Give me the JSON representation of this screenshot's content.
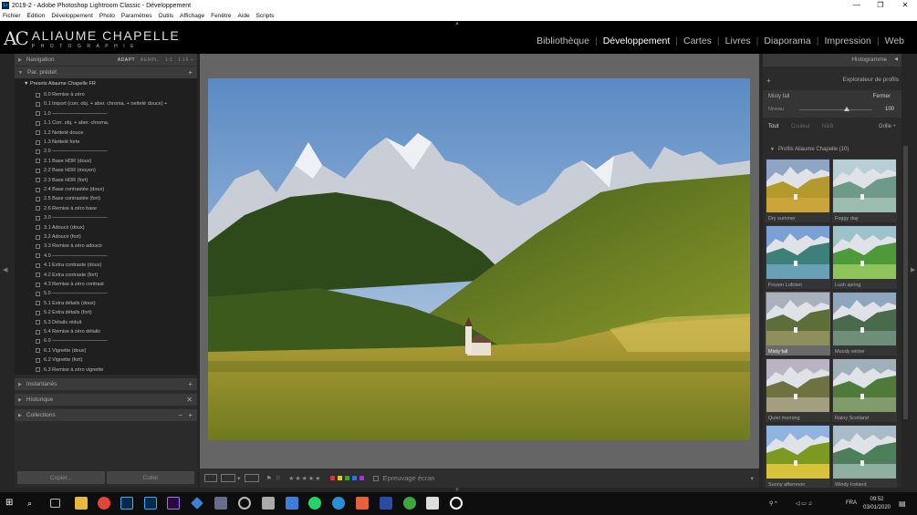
{
  "window": {
    "title": "2019-2 - Adobe Photoshop Lightroom Classic - Développement",
    "controls": [
      "—",
      "❐",
      "✕"
    ]
  },
  "menu": [
    "Fichier",
    "Edition",
    "Développement",
    "Photo",
    "Paramètres",
    "Outils",
    "Affichage",
    "Fenêtre",
    "Aide",
    "Scripts"
  ],
  "identity": {
    "mark": "AC",
    "name": "ALIAUME CHAPELLE",
    "subtitle": "PHOTOGRAPHIE"
  },
  "modules": [
    {
      "label": "Bibliothèque",
      "active": false
    },
    {
      "label": "Développement",
      "active": true
    },
    {
      "label": "Cartes",
      "active": false
    },
    {
      "label": "Livres",
      "active": false
    },
    {
      "label": "Diaporama",
      "active": false
    },
    {
      "label": "Impression",
      "active": false
    },
    {
      "label": "Web",
      "active": false
    }
  ],
  "left_panel": {
    "navigation": {
      "title": "Navigation",
      "modes": [
        "ADAPT",
        "REMPL.",
        "1:1",
        "1:16 ÷"
      ]
    },
    "presets": {
      "title": "Par. prédéf.",
      "folder": "Presets Aliaume Chapelle FR",
      "items": [
        "0.0 Remise à zéro",
        "0.1 Import (corr. obj. + aber. chroma. + netteté douce) +",
        "1.0 ———————————",
        "1.1 Corr. obj. + aber. chroma.",
        "1.2 Netteté douce",
        "1.3 Netteté forte",
        "2.0 ———————————",
        "2.1 Base HDR (doux)",
        "2.2 Base HDR (moyen)",
        "2.3 Base HDR (fort)",
        "2.4 Base contrastée (doux)",
        "2.5 Base contrastée (fort)",
        "2.6 Remise à zéro base",
        "3.0 ———————————",
        "3.1 Adoucir (doux)",
        "3.2 Adoucir (fort)",
        "3.3 Remise à zéro adoucir",
        "4.0 ———————————",
        "4.1 Extra contraste (doux)",
        "4.2 Extra contraste (fort)",
        "4.3 Remise à zéro contrast",
        "5.0 ———————————",
        "5.1 Extra détails (doux)",
        "5.2 Extra détails (fort)",
        "5.3 Détails réduit",
        "5.4 Remise à zéro détails",
        "6.0 ———————————",
        "6.1 Vignette (doux)",
        "6.2 Vignette (fort)",
        "6.3 Remise à zéro vignette"
      ]
    },
    "snapshots": "Instantanés",
    "history": "Historique",
    "collections": "Collections",
    "copy_button": "Copier...",
    "paste_button": "Coller"
  },
  "toolbar": {
    "rating": "★★★★★",
    "soft_proof": "Epreuvage écran",
    "label_colors": [
      "#d83a3a",
      "#e0c62e",
      "#3aa23a",
      "#3a6ed8",
      "#9b3ad8"
    ]
  },
  "right_panel": {
    "histogram": "Histogramme",
    "profile_browser": "Explorateur de profils",
    "current_profile": "Misty fall",
    "close": "Fermer",
    "amount_label": "Niveau",
    "amount_value": "100",
    "amount_level": 0.65,
    "filters": [
      "Tout",
      "Couleur",
      "N&B"
    ],
    "view": "Grille ÷",
    "group": "Profils Aliaume Chapelle (10)",
    "profiles": [
      {
        "name": "Dry summer",
        "sky": "#8fa5c4",
        "land": "#b49a2c",
        "tint": "#c9a53a"
      },
      {
        "name": "Foggy day",
        "sky": "#b9cfd6",
        "land": "#6f9a8a",
        "tint": "#9bbcb0"
      },
      {
        "name": "Frozen Lofoten",
        "sky": "#7aa0d4",
        "land": "#3f7f7a",
        "tint": "#6aa0b5"
      },
      {
        "name": "Lush spring",
        "sky": "#9bc3c9",
        "land": "#4e9a3a",
        "tint": "#8ec55a"
      },
      {
        "name": "Misty fall",
        "sky": "#a9b2bc",
        "land": "#5e6e3a",
        "tint": "#8d8f5c",
        "selected": true
      },
      {
        "name": "Moody winter",
        "sky": "#8ea7bf",
        "land": "#4a6a4c",
        "tint": "#6f8f7a"
      },
      {
        "name": "Quiet morning",
        "sky": "#b9b3c2",
        "land": "#6e7240",
        "tint": "#a49e80"
      },
      {
        "name": "Rainy Scotland",
        "sky": "#9fb0b8",
        "land": "#4f7a3a",
        "tint": "#7f9c6a"
      },
      {
        "name": "Sunny afternoon",
        "sky": "#8fb4e0",
        "land": "#7c9a22",
        "tint": "#d7c23a"
      },
      {
        "name": "Windy Iceland",
        "sky": "#a7bcc6",
        "land": "#4c7f5a",
        "tint": "#8fb0a0"
      }
    ]
  },
  "taskbar": {
    "language": "FRA",
    "time": "09:52",
    "date": "03/01/2020"
  }
}
